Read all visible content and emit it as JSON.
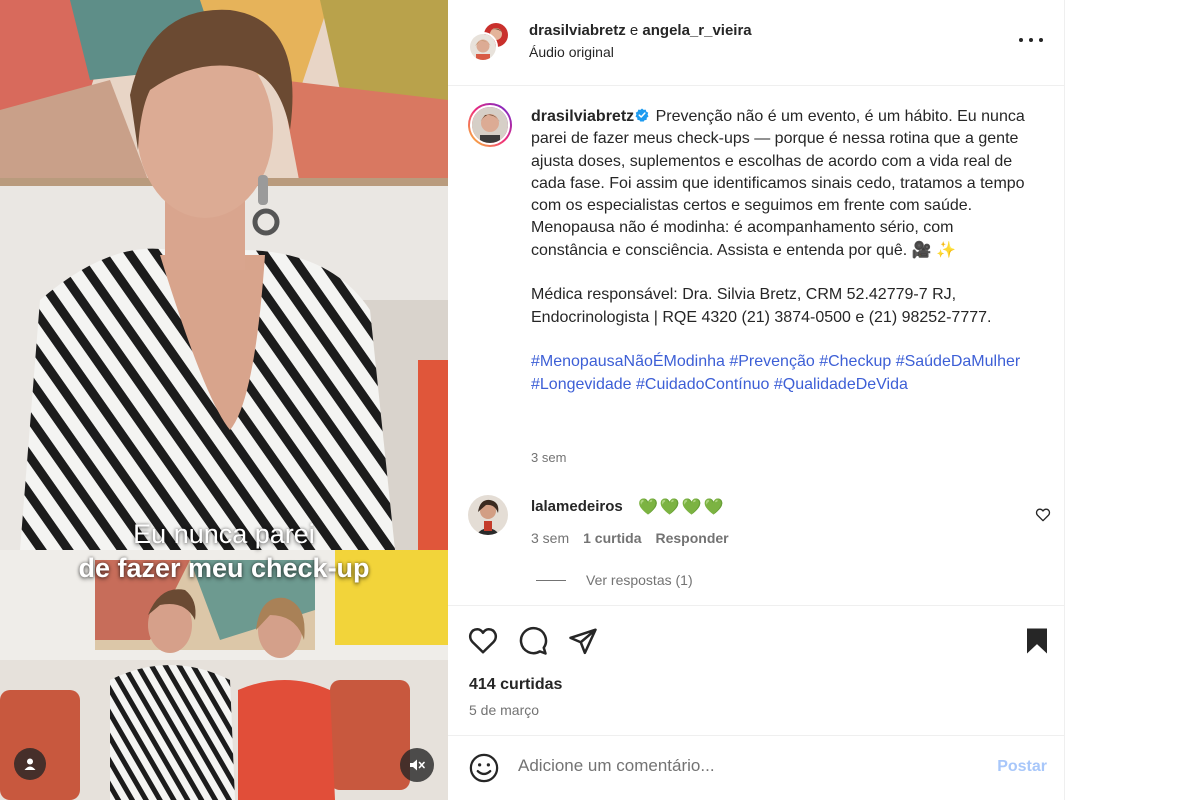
{
  "media": {
    "caption_line1": "Eu nunca parei",
    "caption_line2": "de fazer meu check-up",
    "tag_icon": "user-tag-icon",
    "mute_icon": "speaker-muted-icon"
  },
  "header": {
    "user1": "drasilviabretz",
    "connector": "e",
    "user2": "angela_r_vieira",
    "audio": "Áudio original",
    "more_icon": "more-horizontal-icon"
  },
  "post": {
    "username": "drasilviabretz",
    "verified_icon": "verified-badge-icon",
    "paragraph1": "Prevenção não é um evento, é um hábito. Eu nunca parei de fazer meus check-ups — porque é nessa rotina que a gente ajusta doses, suplementos e escolhas de acordo com a vida real de cada fase. Foi assim que identificamos sinais cedo, tratamos a tempo com os especialistas certos e seguimos em frente com saúde. Menopausa não é modinha: é acompanhamento sério, com constância e consciência. Assista e entenda por quê. 🎥 ✨",
    "paragraph2": "Médica responsável: Dra. Silvia Bretz, CRM 52.42779-7 RJ, Endocrinologista | RQE 4320 (21) 3874-0500 e (21) 98252-7777.",
    "hashtags": "#MenopausaNãoÉModinha #Prevenção #Checkup #SaúdeDaMulher #Longevidade #CuidadoContínuo #QualidadeDeVida",
    "time": "3 sem"
  },
  "comment": {
    "username": "lalamedeiros",
    "text": "💚💚💚💚",
    "time": "3 sem",
    "likes": "1 curtida",
    "reply": "Responder",
    "view_replies": "Ver respostas (1)",
    "heart_icon": "heart-outline-icon"
  },
  "actions": {
    "like_icon": "heart-icon",
    "comment_icon": "comment-icon",
    "share_icon": "send-icon",
    "save_icon": "bookmark-filled-icon",
    "likes_count": "414 curtidas",
    "date": "5 de março"
  },
  "comment_bar": {
    "emoji_icon": "emoji-icon",
    "placeholder": "Adicione um comentário...",
    "post_label": "Postar"
  },
  "colors": {
    "link": "#3d5fd6",
    "muted": "#737373",
    "post_disabled": "#a8c7fa",
    "divider": "#efefef"
  }
}
